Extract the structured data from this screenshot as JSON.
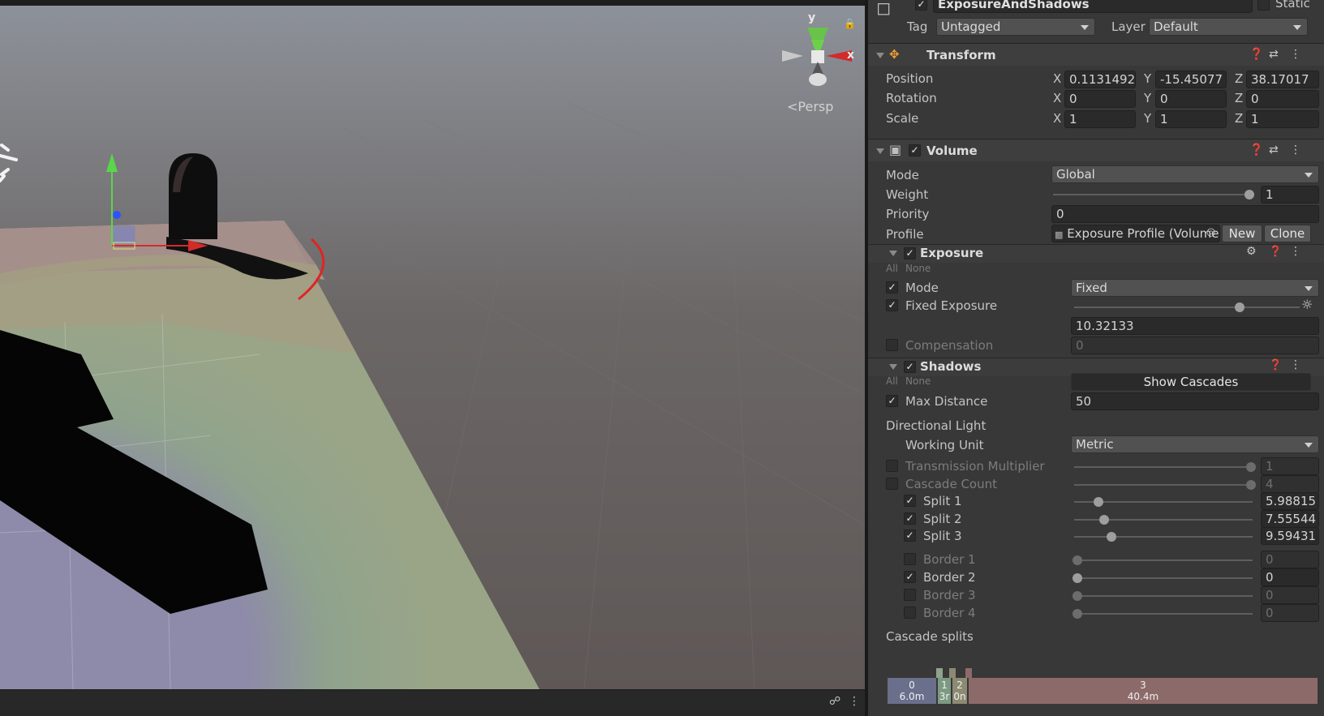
{
  "scene": {
    "persp_label": "Persp",
    "gizmo_axes": {
      "y": "y",
      "x": "x"
    },
    "icons": [
      "sun-icon",
      "move-gizmo-icon",
      "lock-icon",
      "kebab-menu-icon"
    ]
  },
  "object": {
    "name": "ExposureAndShadows",
    "active": true,
    "static_label": "Static",
    "tag_label": "Tag",
    "tag_value": "Untagged",
    "layer_label": "Layer",
    "layer_value": "Default"
  },
  "transform": {
    "title": "Transform",
    "position_label": "Position",
    "rotation_label": "Rotation",
    "scale_label": "Scale",
    "axis_x": "X",
    "axis_y": "Y",
    "axis_z": "Z",
    "position": {
      "x": "0.1131492",
      "y": "-15.45077",
      "z": "38.17017"
    },
    "rotation": {
      "x": "0",
      "y": "0",
      "z": "0"
    },
    "scale": {
      "x": "1",
      "y": "1",
      "z": "1"
    }
  },
  "volume": {
    "title": "Volume",
    "enabled": true,
    "mode_label": "Mode",
    "mode_value": "Global",
    "weight_label": "Weight",
    "weight_value": "1",
    "weight_fraction": 1.0,
    "priority_label": "Priority",
    "priority_value": "0",
    "profile_label": "Profile",
    "profile_value": "Exposure Profile (Volume",
    "new_button": "New",
    "clone_button": "Clone"
  },
  "exposure": {
    "title": "Exposure",
    "all_label": "All",
    "none_label": "None",
    "mode_label": "Mode",
    "mode_value": "Fixed",
    "fixed_exposure_label": "Fixed Exposure",
    "fixed_exposure_value": "10.32133",
    "compensation_label": "Compensation",
    "compensation_value": "0"
  },
  "shadows": {
    "title": "Shadows",
    "all_label": "All",
    "none_label": "None",
    "show_cascades_button": "Show Cascades",
    "max_distance_label": "Max Distance",
    "max_distance_value": "50",
    "directional_light_label": "Directional Light",
    "working_unit_label": "Working Unit",
    "working_unit_value": "Metric",
    "transmission_label": "Transmission  Multiplier",
    "transmission_value": "1",
    "cascade_count_label": "Cascade Count",
    "cascade_count_value": "4",
    "splits": [
      {
        "label": "Split 1",
        "value": "5.98815",
        "enabled": true
      },
      {
        "label": "Split 2",
        "value": "7.55544",
        "enabled": true
      },
      {
        "label": "Split 3",
        "value": "9.59431",
        "enabled": true
      }
    ],
    "borders": [
      {
        "label": "Border 1",
        "value": "0",
        "enabled": false
      },
      {
        "label": "Border 2",
        "value": "0",
        "enabled": true
      },
      {
        "label": "Border 3",
        "value": "0",
        "enabled": false
      },
      {
        "label": "Border 4",
        "value": "0",
        "enabled": false
      }
    ],
    "cascade_splits_label": "Cascade splits",
    "cascades": [
      {
        "index": "0",
        "distance": "6.0m",
        "color": "#6a6f8c"
      },
      {
        "index": "1",
        "distance": "3r",
        "color": "#7c9a82"
      },
      {
        "index": "2",
        "distance": "0n",
        "color": "#8d8a73"
      },
      {
        "index": "3",
        "distance": "40.4m",
        "color": "#8d6a6a"
      }
    ]
  }
}
